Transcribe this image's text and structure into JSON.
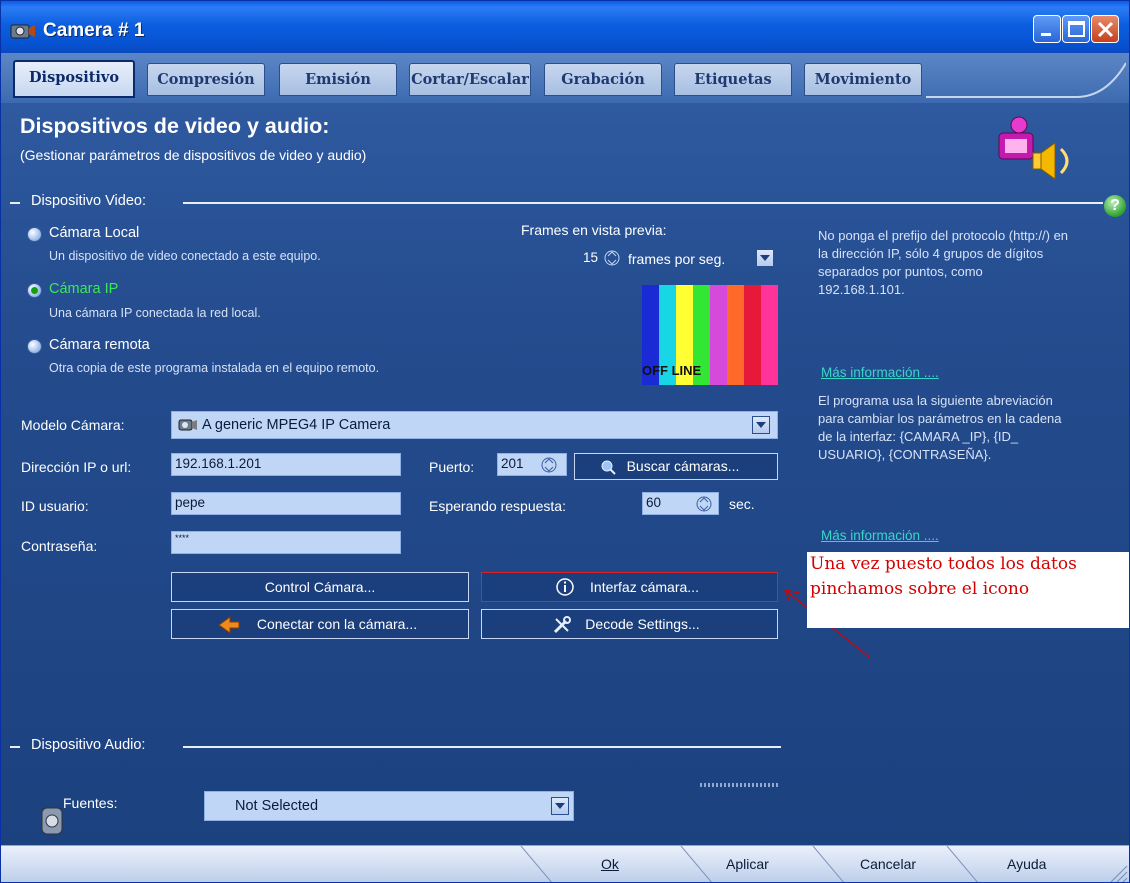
{
  "window": {
    "title": "Camera # 1"
  },
  "tabs": [
    {
      "label": "Dispositivo",
      "active": true
    },
    {
      "label": "Compresión",
      "active": false
    },
    {
      "label": "Emisión",
      "active": false
    },
    {
      "label": "Cortar/Escalar",
      "active": false
    },
    {
      "label": "Grabación",
      "active": false
    },
    {
      "label": "Etiquetas",
      "active": false
    },
    {
      "label": "Movimiento",
      "active": false
    }
  ],
  "header": {
    "title": "Dispositivos de video y audio:",
    "subtitle": "(Gestionar parámetros de dispositivos de video y audio)"
  },
  "video": {
    "section_title": "Dispositivo Video:",
    "radios": [
      {
        "label": "Cámara Local",
        "desc": "Un dispositivo de video conectado a este equipo.",
        "checked": false
      },
      {
        "label": "Cámara IP",
        "desc": "Una cámara IP conectada la red local.",
        "checked": true
      },
      {
        "label": "Cámara remota",
        "desc": "Otra copia de este programa instalada en el equipo remoto.",
        "checked": false
      }
    ],
    "preview": {
      "label": "Frames en vista previa:",
      "fps_value": "15",
      "fps_unit": "frames por seg.",
      "offline_text": "OFF LINE",
      "bars": [
        "#1a2bd6",
        "#19d6e6",
        "#ffff33",
        "#33e633",
        "#d64adb",
        "#ff6a2a",
        "#e6193a",
        "#ff3399"
      ]
    },
    "model": {
      "label": "Modelo Cámara:",
      "value": "A generic MPEG4 IP Camera"
    },
    "ip": {
      "label": "Dirección IP o url:",
      "value": "192.168.1.201"
    },
    "port": {
      "label": "Puerto:",
      "value": "201"
    },
    "search_button": "Buscar cámaras...",
    "user": {
      "label": "ID usuario:",
      "value": "pepe"
    },
    "wait": {
      "label": "Esperando respuesta:",
      "value": "60",
      "unit": "sec."
    },
    "password": {
      "label": "Contraseña:",
      "value": "****"
    },
    "buttons": {
      "control": "Control Cámara...",
      "interface": "Interfaz cámara...",
      "connect": "Conectar con la cámara...",
      "decode": "Decode Settings..."
    }
  },
  "help": {
    "text1": [
      "No ponga el prefijo del protocolo (http://) en",
      "la dirección IP, sólo 4 grupos de dígitos",
      "separados por puntos, como",
      "192.168.1.101."
    ],
    "link1": "Más información ....",
    "text2": [
      "El programa usa la siguiente abreviación",
      "para cambiar los parámetros en la cadena",
      "de la interfaz: {CAMARA _IP}, {ID_",
      "USUARIO}, {CONTRASEÑA}."
    ],
    "link2": "Más información ....",
    "badge": "?"
  },
  "annotation": {
    "line1": "Una vez puesto todos los datos",
    "line2": "pinchamos sobre el icono"
  },
  "audio": {
    "section_title": "Dispositivo Audio:",
    "sources_label": "Fuentes:",
    "sources_value": "Not Selected"
  },
  "footer": {
    "ok": "Ok",
    "apply": "Aplicar",
    "cancel": "Cancelar",
    "help": "Ayuda"
  },
  "colors": {
    "accent": "#0654d4",
    "panel": "#244c8e",
    "annotation": "#d40000",
    "link": "#39d6c8"
  }
}
